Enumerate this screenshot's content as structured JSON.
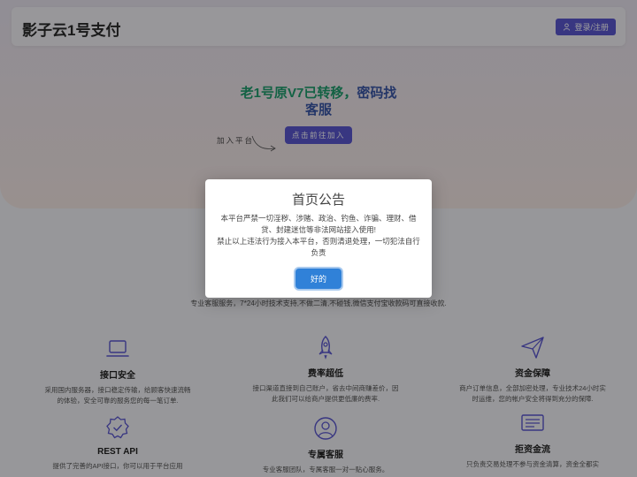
{
  "header": {
    "brand": "影子云1号支付",
    "login_label": "登录/注册"
  },
  "hero": {
    "title_green": "老1号原V7已转移，",
    "title_blue": "密码找",
    "title_line2": "客服",
    "join_label": "加入平台",
    "join_button": "点击前往加入"
  },
  "tagline": "专业客服服务，7*24小时技术支持,不做二清,不碰钱,微信支付宝收款码可直接收款.",
  "features": [
    {
      "icon": "laptop-icon",
      "title": "接口安全",
      "desc": "采用国内服务器，接口稳定传输，给顾客快速流畅的体验，安全可靠的服务您的每一笔订单."
    },
    {
      "icon": "rocket-icon",
      "title": "费率超低",
      "desc": "接口渠道直接到自己账户，省去中间商赚差价，因此我们可以给商户提供更低廉的费率."
    },
    {
      "icon": "send-icon",
      "title": "资金保障",
      "desc": "商户订单信息，全部加密处理，专业技术24小时实时运维，您的帐户安全将得到充分的保障."
    },
    {
      "icon": "badge-check-icon",
      "title": "REST API",
      "desc": "提供了完善的API接口，你可以用于平台应用"
    },
    {
      "icon": "user-circle-icon",
      "title": "专属客服",
      "desc": "专业客服团队，专属客服一对一贴心服务。"
    },
    {
      "icon": "list-icon",
      "title": "拒资金流",
      "desc": "只负责交易处理不参与资金清算，资金全都实"
    }
  ],
  "modal": {
    "title": "首页公告",
    "line1": "本平台严禁一切淫秽、涉赌、政治、钓鱼、诈骗、理财、借贷、封建迷信等非法网站接入使用!",
    "line2": "禁止以上违法行为接入本平台，否则清退处理，一切犯法自行负责",
    "ok_label": "好的"
  },
  "colors": {
    "accent": "#5b57d1",
    "ok_button": "#3081d8",
    "title_green": "#1f9e6e",
    "title_blue": "#3b58a8"
  }
}
